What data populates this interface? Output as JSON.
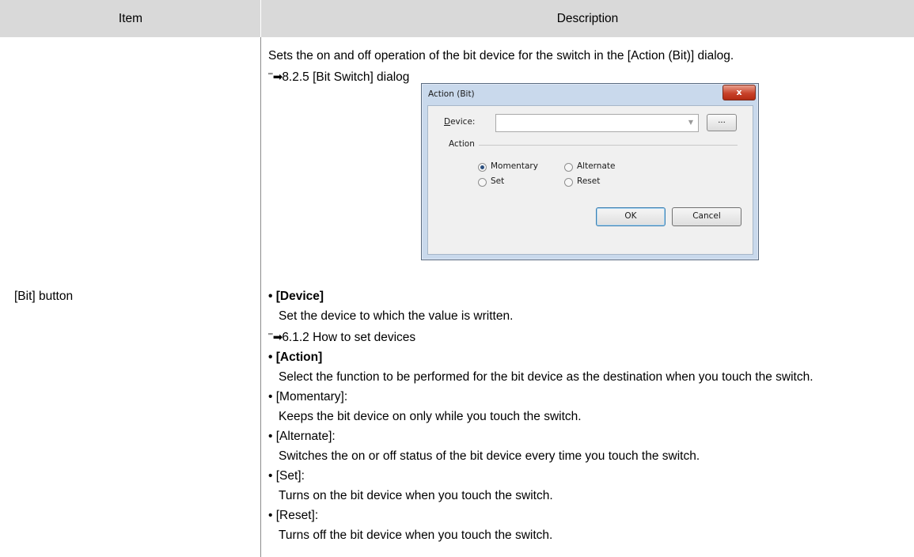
{
  "table": {
    "header": {
      "item": "Item",
      "description": "Description"
    },
    "item_label": "[Bit] button"
  },
  "description": {
    "intro": "Sets the on and off operation of the bit device for the switch in the [Action (Bit)] dialog.",
    "ref1": "8.2.5 [Bit Switch] dialog",
    "device_heading": "• [Device]",
    "device_text": "Set the device to which the value is written.",
    "ref2": "6.1.2 How to set devices",
    "action_heading": "• [Action]",
    "action_text": "Select the function to be performed for the bit device as the destination when you touch the switch.",
    "momentary_heading": "• [Momentary]:",
    "momentary_text": "Keeps the bit device on only while you touch the switch.",
    "alternate_heading": "• [Alternate]:",
    "alternate_text": "Switches the on or off status of the bit device every time you touch the switch.",
    "set_heading": "• [Set]:",
    "set_text": "Turns on the bit device when you touch the switch.",
    "reset_heading": "• [Reset]:",
    "reset_text": "Turns off the bit device when you touch the switch."
  },
  "dialog": {
    "title": "Action (Bit)",
    "close_label": "x",
    "device_label_underlined": "D",
    "device_label_rest": "evice:",
    "device_value": "",
    "browse_label": "...",
    "action_group": "Action",
    "radio_momentary": "Momentary",
    "radio_alternate": "Alternate",
    "radio_set": "Set",
    "radio_reset": "Reset",
    "selected": "Momentary",
    "ok_label": "OK",
    "cancel_label": "Cancel"
  },
  "icons": {
    "reference_arrow": "reference-arrow-icon",
    "combo_arrow": "chevron-down-icon"
  }
}
